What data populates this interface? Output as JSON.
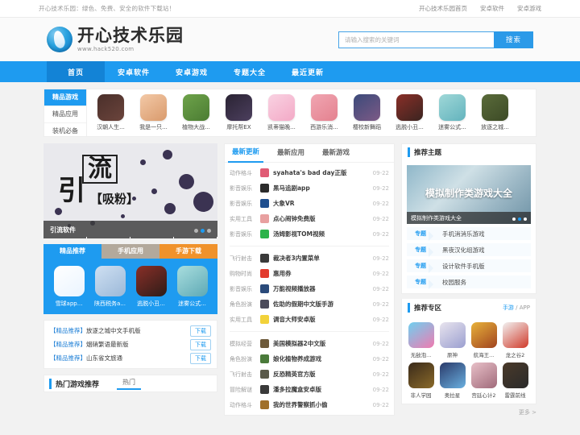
{
  "topbar": {
    "slogan": "开心技术乐园：绿色、免费、安全的软件下载站！",
    "links": [
      "开心技术乐园首页",
      "安卓软件",
      "安卓游戏"
    ]
  },
  "header": {
    "brand_title": "开心技术乐园",
    "brand_url": "www.hack520.com",
    "search_placeholder": "请输入搜索的关键词",
    "search_value": "",
    "search_button": "搜索"
  },
  "nav": {
    "items": [
      {
        "label": "首页",
        "active": true
      },
      {
        "label": "安卓软件",
        "active": false
      },
      {
        "label": "安卓游戏",
        "active": false
      },
      {
        "label": "专题大全",
        "active": false
      },
      {
        "label": "最近更新",
        "active": false
      }
    ]
  },
  "category_strip": {
    "menu": [
      {
        "label": "精品游戏",
        "active": true
      },
      {
        "label": "精品应用",
        "active": false
      },
      {
        "label": "装机必备",
        "active": false
      }
    ],
    "apps": [
      {
        "name": "汉朝人生...",
        "c1": "#4a2f2a",
        "c2": "#6b443c"
      },
      {
        "name": "我是一只...",
        "c1": "#f3c9a7",
        "c2": "#d99a6c"
      },
      {
        "name": "植物大战...",
        "c1": "#6ea34a",
        "c2": "#4b7c33"
      },
      {
        "name": "摩托帮EX",
        "c1": "#2a2333",
        "c2": "#4c3f5e"
      },
      {
        "name": "凯蒂猫晚...",
        "c1": "#f9d2e2",
        "c2": "#f3a9c6"
      },
      {
        "name": "西游乐消...",
        "c1": "#f0a6b2",
        "c2": "#e4818f"
      },
      {
        "name": "樱校新舞蹈",
        "c1": "#3b4a7a",
        "c2": "#7d5a86"
      },
      {
        "name": "逃脱小丑...",
        "c1": "#8a2f28",
        "c2": "#3a2420"
      },
      {
        "name": "迷雾公式...",
        "c1": "#9fd8d8",
        "c2": "#63b3bd"
      },
      {
        "name": "放逐之城...",
        "c1": "#5a6b3a",
        "c2": "#3c4a26"
      }
    ]
  },
  "banner": {
    "word_big": "流",
    "word_left": "引",
    "word_sub": "【吸粉】",
    "caption": "引流软件",
    "slides": 3,
    "active_slide": 1
  },
  "recommend_tabs": {
    "tabs": [
      "精品推荐",
      "手机应用",
      "手游下载"
    ],
    "apps": [
      {
        "name": "雪球app...",
        "c1": "#ffffff",
        "c2": "#eaf4ff"
      },
      {
        "name": "陕西税务a...",
        "c1": "#cfe0f2",
        "c2": "#9bb8d8"
      },
      {
        "name": "逃脱小丑...",
        "c1": "#8a2f28",
        "c2": "#2d1c18"
      },
      {
        "name": "迷雾公式...",
        "c1": "#a9dede",
        "c2": "#5ea9b5"
      }
    ]
  },
  "download_list": {
    "items": [
      {
        "tag": "【精品推荐】",
        "title": "放逐之城中文手机版",
        "button": "下载"
      },
      {
        "tag": "【精品推荐】",
        "title": "烟硝繁语最新版",
        "button": "下载"
      },
      {
        "tag": "【精品推荐】",
        "title": "山东省文旅通",
        "button": "下载"
      }
    ]
  },
  "hot_bar": {
    "title": "热门游戏推荐",
    "sub": "热门"
  },
  "center": {
    "tabs": [
      {
        "label": "最新更新",
        "active": true
      },
      {
        "label": "最新应用",
        "active": false
      },
      {
        "label": "最新游戏",
        "active": false
      }
    ],
    "groups": [
      [
        {
          "cat": "动作格斗",
          "title": "syahata's bad day正版",
          "date": "09-22",
          "color": "#e05b74"
        },
        {
          "cat": "影音娱乐",
          "title": "黑马追剧app",
          "date": "09-22",
          "color": "#2b2b2b"
        },
        {
          "cat": "影音娱乐",
          "title": "大象VR",
          "date": "09-22",
          "color": "#1f4f8f"
        },
        {
          "cat": "实用工具",
          "title": "点心闹钟免费版",
          "date": "09-22",
          "color": "#e8a0a0"
        },
        {
          "cat": "影音娱乐",
          "title": "汤姆影视TOM视频",
          "date": "09-22",
          "color": "#2cb34a"
        }
      ],
      [
        {
          "cat": "飞行射击",
          "title": "裁决者3内置菜单",
          "date": "09-22",
          "color": "#3a3a3a"
        },
        {
          "cat": "购物时尚",
          "title": "惠用券",
          "date": "09-22",
          "color": "#e23b2e"
        },
        {
          "cat": "影音娱乐",
          "title": "万能视频播放器",
          "date": "09-22",
          "color": "#2a4a7a"
        },
        {
          "cat": "角色扮演",
          "title": "佐助的假期中文版手游",
          "date": "09-22",
          "color": "#4b4b5a"
        },
        {
          "cat": "实用工具",
          "title": "调音大师安卓版",
          "date": "09-22",
          "color": "#f2d23a"
        }
      ],
      [
        {
          "cat": "模拟经营",
          "title": "美国模拟器2中文版",
          "date": "09-22",
          "color": "#6d5a3a"
        },
        {
          "cat": "角色扮演",
          "title": "娘化植物养成游戏",
          "date": "09-22",
          "color": "#4a7a3a"
        },
        {
          "cat": "飞行射击",
          "title": "反恐精英官方版",
          "date": "09-22",
          "color": "#5a5a4a"
        },
        {
          "cat": "冒险解谜",
          "title": "潘多拉魔盒安卓版",
          "date": "09-22",
          "color": "#3a3a3a"
        },
        {
          "cat": "动作格斗",
          "title": "我的世界警察抓小偷",
          "date": "09-22",
          "color": "#a0702a"
        }
      ]
    ]
  },
  "right": {
    "topic_panel": {
      "title": "推荐主题",
      "thumb_title": "模拟制作类游戏大全",
      "thumb_caption": "模拟制作类游戏大全",
      "slides": 3,
      "active_slide": 2,
      "topics": [
        {
          "tag": "专题",
          "label": "手机消消乐游戏"
        },
        {
          "tag": "专题",
          "label": "黑夜汉化组游戏"
        },
        {
          "tag": "专题",
          "label": "设计软件手机版"
        },
        {
          "tag": "专题",
          "label": "校园服务"
        }
      ]
    },
    "zone_panel": {
      "title": "推荐专区",
      "filter_active": "手游",
      "filter_sep": "/",
      "filter_other": "APP",
      "games": [
        {
          "name": "无敌泡...",
          "c1": "#6fd0f0",
          "c2": "#f07ab0"
        },
        {
          "name": "原神",
          "c1": "#e8e4ee",
          "c2": "#9b9fd0"
        },
        {
          "name": "航海王...",
          "c1": "#e8b23a",
          "c2": "#a0431f"
        },
        {
          "name": "龙之谷2",
          "c1": "#f2f2f2",
          "c2": "#d03a2a"
        },
        {
          "name": "非人学园",
          "c1": "#3a2a1a",
          "c2": "#8a6a2a"
        },
        {
          "name": "奥拉星",
          "c1": "#2a3a6a",
          "c2": "#6ab0e0"
        },
        {
          "name": "宫廷心计2",
          "c1": "#e8c0c8",
          "c2": "#a06a7a"
        },
        {
          "name": "雷霆前线",
          "c1": "#4a3a2a",
          "c2": "#2a2a2a"
        }
      ]
    },
    "more_label": "更多 >"
  }
}
